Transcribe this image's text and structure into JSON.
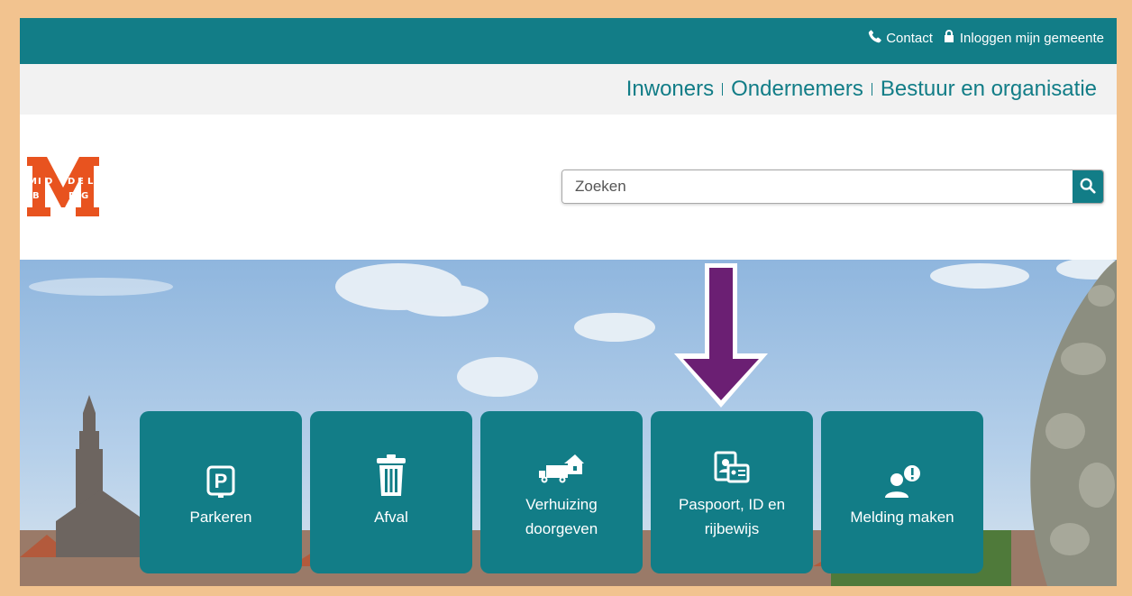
{
  "topbar": {
    "contact_label": "Contact",
    "login_label": "Inloggen mijn gemeente"
  },
  "nav": {
    "items": [
      "Inwoners",
      "Ondernemers",
      "Bestuur en organisatie"
    ]
  },
  "logo": {
    "letter": "M",
    "text_top": "MIDDEL",
    "text_bottom": "BURG"
  },
  "search": {
    "placeholder": "Zoeken"
  },
  "tiles": [
    {
      "label": "Parkeren",
      "icon": "parking-icon"
    },
    {
      "label": "Afval",
      "icon": "trash-icon"
    },
    {
      "label": "Verhuizing\ndoorgeven",
      "icon": "moving-truck-icon"
    },
    {
      "label": "Paspoort, ID en\nrijbewijs",
      "icon": "id-card-icon"
    },
    {
      "label": "Melding maken",
      "icon": "report-person-icon"
    }
  ],
  "colors": {
    "brand": "#127d87",
    "logo": "#e8531f",
    "arrow": "#6b1f73",
    "frame": "#f2c38f"
  }
}
